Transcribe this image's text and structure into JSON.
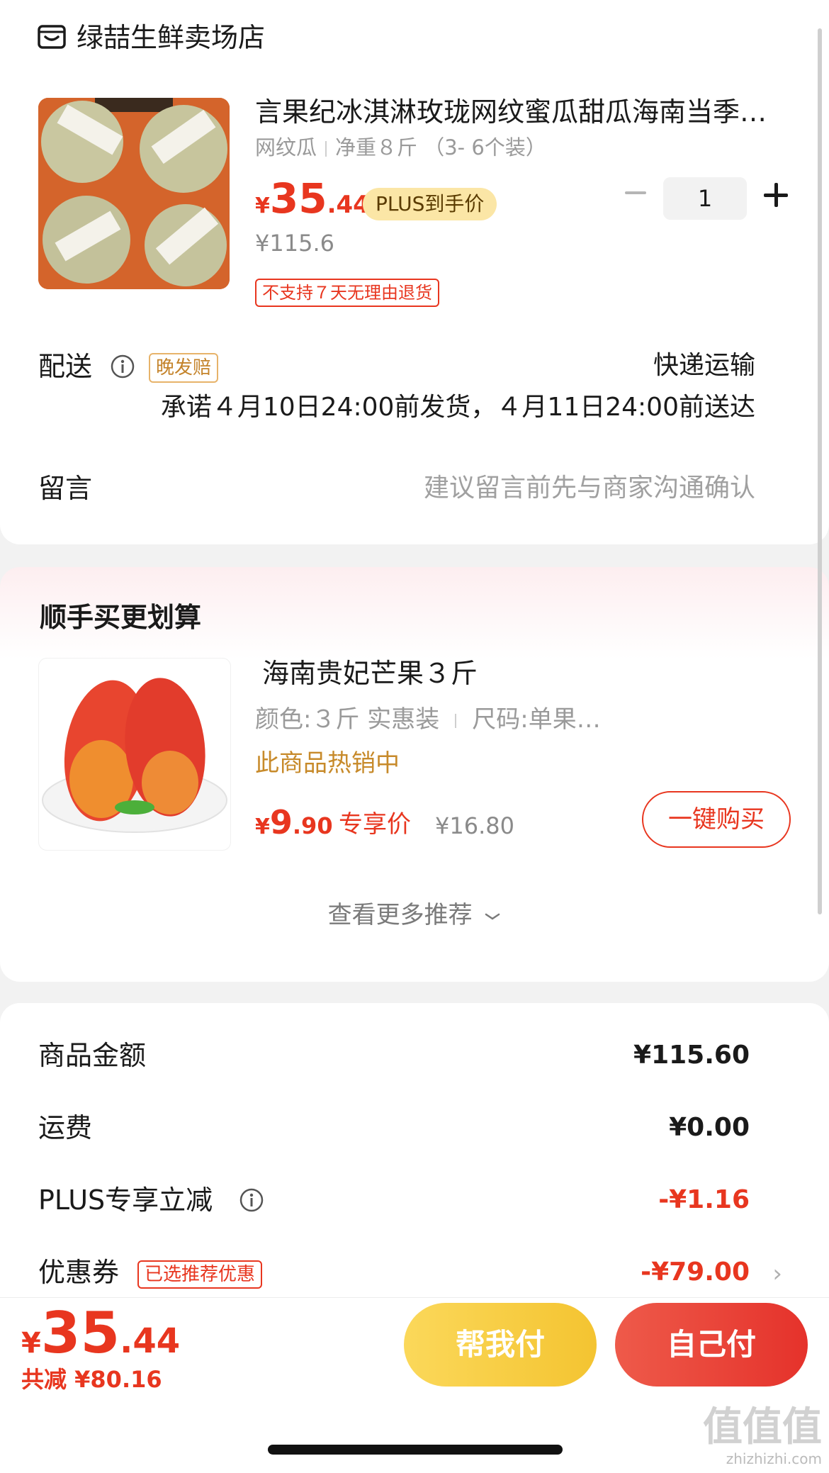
{
  "shop": {
    "name": "绿喆生鲜卖场店",
    "icon": "shop-icon"
  },
  "product": {
    "title": "言果纪冰淇淋玫珑网纹蜜瓜甜瓜海南当季…",
    "spec_variety": "网纹瓜",
    "spec_weight": "净重８斤 （3- 6个装）",
    "price_symbol": "¥",
    "price_int": "35",
    "price_dec": ".44",
    "plus_badge": "PLUS到手价",
    "original_price": "¥115.6",
    "return_policy": "不支持７天无理由退货",
    "quantity": "1"
  },
  "delivery": {
    "label": "配送",
    "late_badge": "晚发赔",
    "method": "快递运输",
    "promise": "承诺４月10日24:00前发货，４月11日24:00前送达"
  },
  "message": {
    "label": "留言",
    "hint": "建议留言前先与商家沟通确认"
  },
  "recommend": {
    "title": "顺手买更划算",
    "item": {
      "title": "海南贵妃芒果３斤",
      "spec_color": "颜色:３斤 实惠装",
      "spec_size": "尺码:单果…",
      "hot": "此商品热销中",
      "price_symbol": "¥",
      "price_int": "9",
      "price_dec": ".90",
      "exclusive_label": "专享价",
      "original_price": "¥16.80",
      "buy_label": "一键购买"
    },
    "more": "查看更多推荐"
  },
  "summary": {
    "goods_label": "商品金额",
    "goods_value": "¥115.60",
    "shipping_label": "运费",
    "shipping_value": "¥0.00",
    "plus_label": "PLUS专享立减",
    "plus_value": "-¥1.16",
    "coupon_label": "优惠券",
    "coupon_badge": "已选推荐优惠",
    "coupon_value": "-¥79.00"
  },
  "checkout": {
    "total_symbol": "¥",
    "total_int": "35",
    "total_dec": ".44",
    "saving": "共减 ¥80.16",
    "help_pay": "帮我付",
    "self_pay": "自己付"
  },
  "watermark": {
    "text": "值值值",
    "url": "zhizhizhi.com"
  },
  "colors": {
    "accent": "#e8361f",
    "gold": "#f4c431",
    "plus_badge_bg": "#fbe6a6"
  }
}
